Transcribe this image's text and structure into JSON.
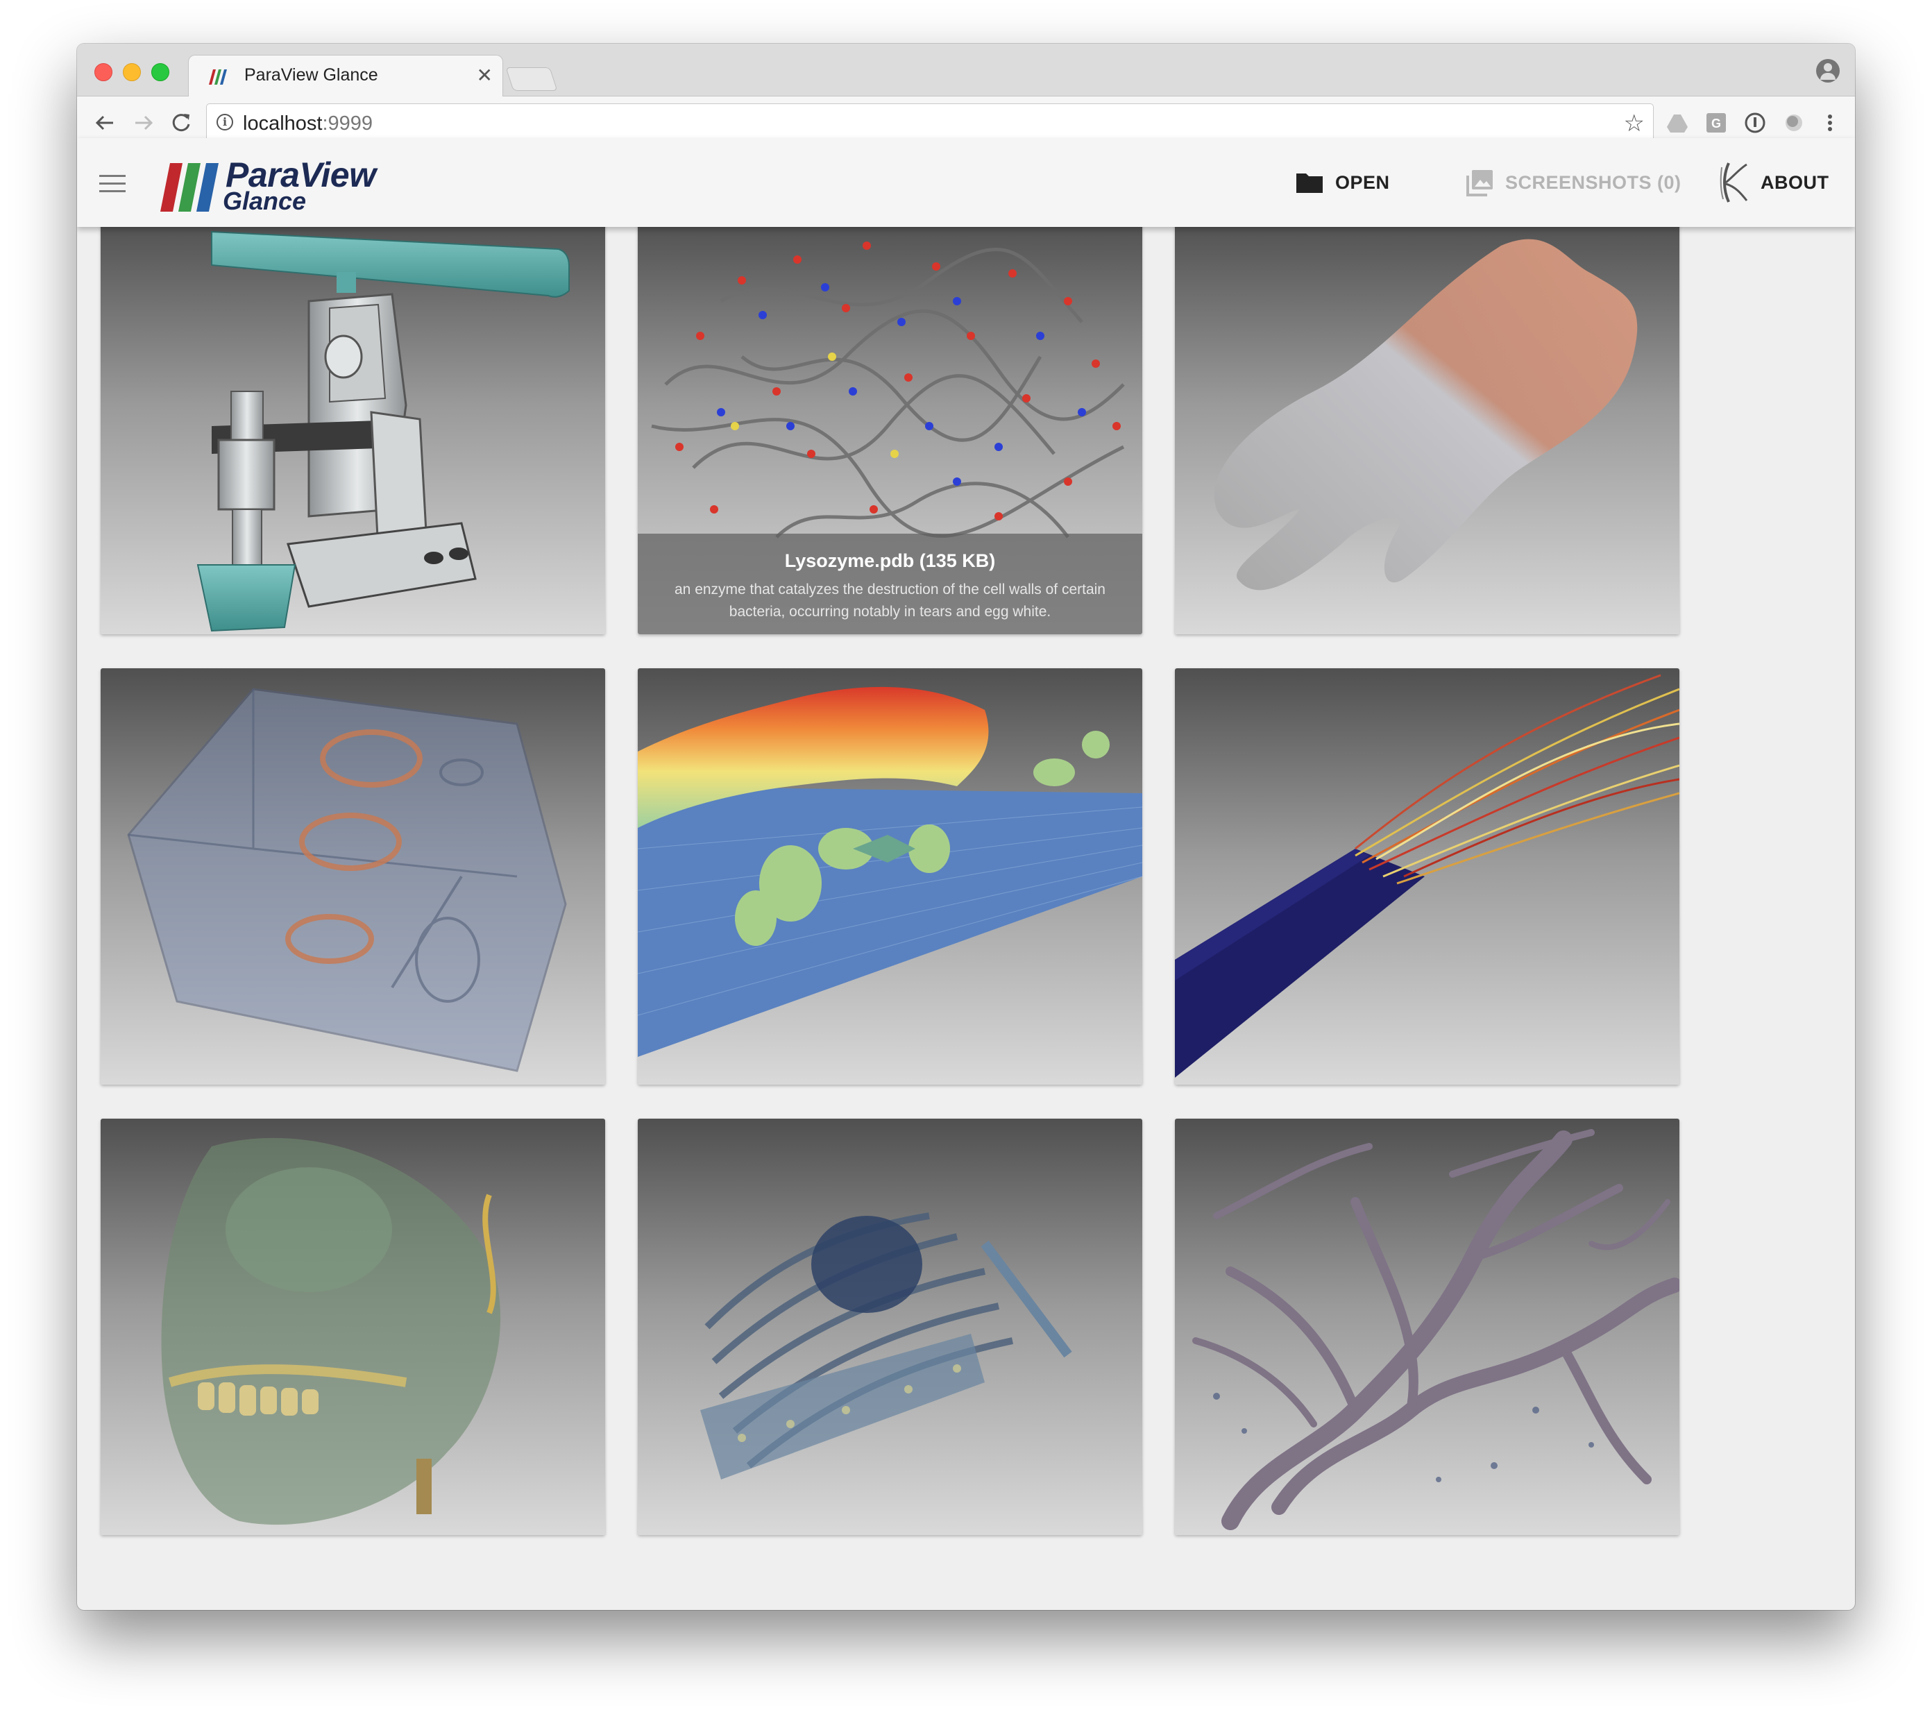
{
  "browser": {
    "tab_title": "ParaView Glance",
    "url_host": "localhost",
    "url_port": ":9999"
  },
  "app": {
    "logo_title": "ParaView",
    "logo_subtitle": "Glance",
    "nav": {
      "open_label": "OPEN",
      "screenshots_label": "SCREENSHOTS (0)",
      "about_label": "ABOUT"
    }
  },
  "gallery": {
    "items": [
      {
        "icon": "vise-clamp-render",
        "title": "",
        "description": ""
      },
      {
        "icon": "molecule-render",
        "title": "Lysozyme.pdb (135 KB)",
        "description": "an enzyme that catalyzes the destruction of the cell walls of certain bacteria, occurring notably in tears and egg white."
      },
      {
        "icon": "tooth-render",
        "title": "",
        "description": ""
      },
      {
        "icon": "engine-block-render",
        "title": "",
        "description": ""
      },
      {
        "icon": "lidar-terrain-render",
        "title": "",
        "description": ""
      },
      {
        "icon": "streamlines-render",
        "title": "",
        "description": ""
      },
      {
        "icon": "skull-render",
        "title": "",
        "description": ""
      },
      {
        "icon": "chest-ct-render",
        "title": "",
        "description": ""
      },
      {
        "icon": "blood-vessels-render",
        "title": "",
        "description": ""
      }
    ]
  },
  "colors": {
    "logo_red": "#c0282d",
    "logo_green": "#3a9b48",
    "logo_blue": "#2862a8",
    "logo_text": "#1c2a54"
  }
}
